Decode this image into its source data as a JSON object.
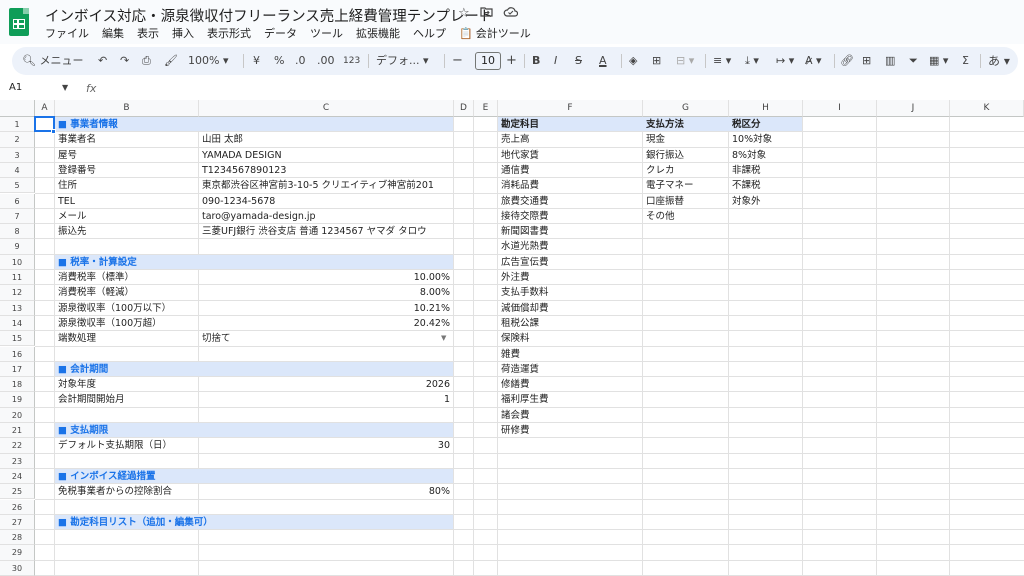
{
  "app": {
    "doc_title": "インボイス対応・源泉徴収付フリーランス売上経費管理テンプレート",
    "star_icon": "star-icon",
    "menu": [
      "ファイル",
      "編集",
      "表示",
      "挿入",
      "表示形式",
      "データ",
      "ツール",
      "拡張機能",
      "ヘルプ",
      "会計ツール"
    ]
  },
  "toolbar": {
    "search_label": "メニュー",
    "zoom": "100%",
    "currency": "¥",
    "percent": "%",
    "dec_decrease": ".0",
    "dec_increase": ".00",
    "number_format": "123",
    "font": "デフォ...",
    "font_size": "10",
    "input_tool": "あ"
  },
  "formula_bar": {
    "name_box": "A1",
    "fx": "fx"
  },
  "columns": [
    "A",
    "B",
    "C",
    "D",
    "E",
    "F",
    "G",
    "H",
    "I",
    "J",
    "K"
  ],
  "rows": [
    "1",
    "2",
    "3",
    "4",
    "5",
    "6",
    "7",
    "8",
    "9",
    "10",
    "11",
    "12",
    "13",
    "14",
    "15",
    "16",
    "17",
    "18",
    "19",
    "20",
    "21",
    "22",
    "23",
    "24",
    "25",
    "26",
    "27",
    "28",
    "29",
    "30"
  ],
  "sheet": {
    "business": {
      "section": "■ 事業者情報",
      "items": [
        {
          "label": "事業者名",
          "value": "山田 太郎"
        },
        {
          "label": "屋号",
          "value": "YAMADA DESIGN"
        },
        {
          "label": "登録番号",
          "value": "T1234567890123"
        },
        {
          "label": "住所",
          "value": "東京都渋谷区神宮前3-10-5 クリエイティブ神宮前201"
        },
        {
          "label": "TEL",
          "value": "090-1234-5678"
        },
        {
          "label": "メール",
          "value": "taro@yamada-design.jp"
        },
        {
          "label": "振込先",
          "value": "三菱UFJ銀行 渋谷支店 普通 1234567 ヤマダ タロウ"
        }
      ]
    },
    "tax": {
      "section": "■ 税率・計算設定",
      "items": [
        {
          "label": "消費税率（標準）",
          "value": "10.00%"
        },
        {
          "label": "消費税率（軽減）",
          "value": "8.00%"
        },
        {
          "label": "源泉徴収率（100万以下）",
          "value": "10.21%"
        },
        {
          "label": "源泉徴収率（100万超）",
          "value": "20.42%"
        }
      ],
      "rounding_label": "端数処理",
      "rounding_value": "切捨て"
    },
    "period": {
      "section": "■ 会計期間",
      "items": [
        {
          "label": "対象年度",
          "value": "2026"
        },
        {
          "label": "会計期間開始月",
          "value": "1"
        }
      ]
    },
    "payment": {
      "section": "■ 支払期限",
      "items": [
        {
          "label": "デフォルト支払期限（日）",
          "value": "30"
        }
      ]
    },
    "invoice": {
      "section": "■ インボイス経過措置",
      "items": [
        {
          "label": "免税事業者からの控除割合",
          "value": "80%"
        }
      ]
    },
    "accounts_section": "■ 勘定科目リスト（追加・編集可）",
    "accounts_header": "勘定科目",
    "accounts": [
      "売上高",
      "地代家賃",
      "通信費",
      "消耗品費",
      "旅費交通費",
      "接待交際費",
      "新聞図書費",
      "水道光熱費",
      "広告宣伝費",
      "外注費",
      "支払手数料",
      "減価償却費",
      "租税公課",
      "保険料",
      "雑費",
      "荷造運賃",
      "修繕費",
      "福利厚生費",
      "諸会費",
      "研修費"
    ],
    "payment_methods_header": "支払方法",
    "payment_methods": [
      "現金",
      "銀行振込",
      "クレカ",
      "電子マネー",
      "口座振替",
      "その他"
    ],
    "tax_categories_header": "税区分",
    "tax_categories": [
      "10%対象",
      "8%対象",
      "非課税",
      "不課税",
      "対象外"
    ]
  }
}
